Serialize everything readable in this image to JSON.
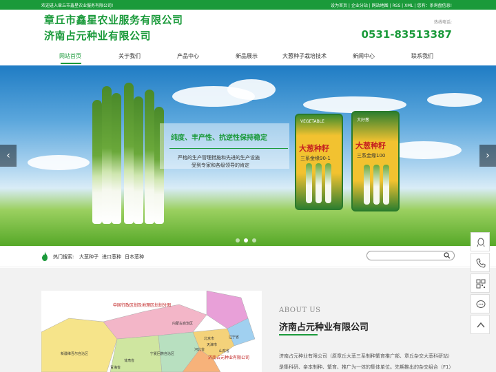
{
  "topbar": {
    "welcome": "欢迎进入章丘市鑫星农业服务有限公司!",
    "links": "设为首页 | 企业分站 | 网站地图 | RSS | XML | 您有：条询盘信息!"
  },
  "header": {
    "company_1": "章丘市鑫星农业服务有限公司",
    "company_2": "济南占元种业有限公司",
    "hotline_label": "热线电话:",
    "hotline": "0531-83513387"
  },
  "nav": {
    "items": [
      "网站首页",
      "关于我们",
      "产品中心",
      "新品展示",
      "大葱种子栽培技术",
      "新闻中心",
      "联系我们"
    ],
    "active_index": 0
  },
  "banner": {
    "headline": "纯度、丰产性、抗逆性保持稳定",
    "sub_1": "严格的生产管理措施和先进的生产设施",
    "sub_2": "受到专家和各级领导的肯定",
    "can_1_title": "大葱种籽",
    "can_1_sub": "三系金缘90-1",
    "can_1_small": "VEGETABLE",
    "can_2_title": "大葱种籽",
    "can_2_sub": "三系金缘100",
    "can_2_small": "大好葱",
    "prev_label": "‹",
    "next_label": "›",
    "slide_count": 3,
    "active_slide": 1
  },
  "search": {
    "hot_label": "热门搜索:",
    "keywords": [
      "大葱种子",
      "进口葱种",
      "日本葱种"
    ],
    "placeholder": ""
  },
  "about": {
    "map_title": "中国行政区划及地理区划划分图",
    "map_labels": [
      "新疆维吾尔自治区",
      "内蒙古自治区",
      "辽宁省",
      "北京市",
      "天津市",
      "山东省",
      "河北省",
      "宁夏回族自治区",
      "甘肃省",
      "青海省"
    ],
    "map_pin": "济南占元种业有限公司",
    "title_en": "ABOUT US",
    "title": "济南占元种业有限公司",
    "text": "济南占元种业有限公司（原章丘大葱三系制种繁育推广部、章丘杂交大葱科研站）是集科研、亲本制种、繁育、推广为一体的集体单位。先期推出的杂交组合（F1）"
  },
  "colors": {
    "brand_green": "#1a9a3a"
  }
}
